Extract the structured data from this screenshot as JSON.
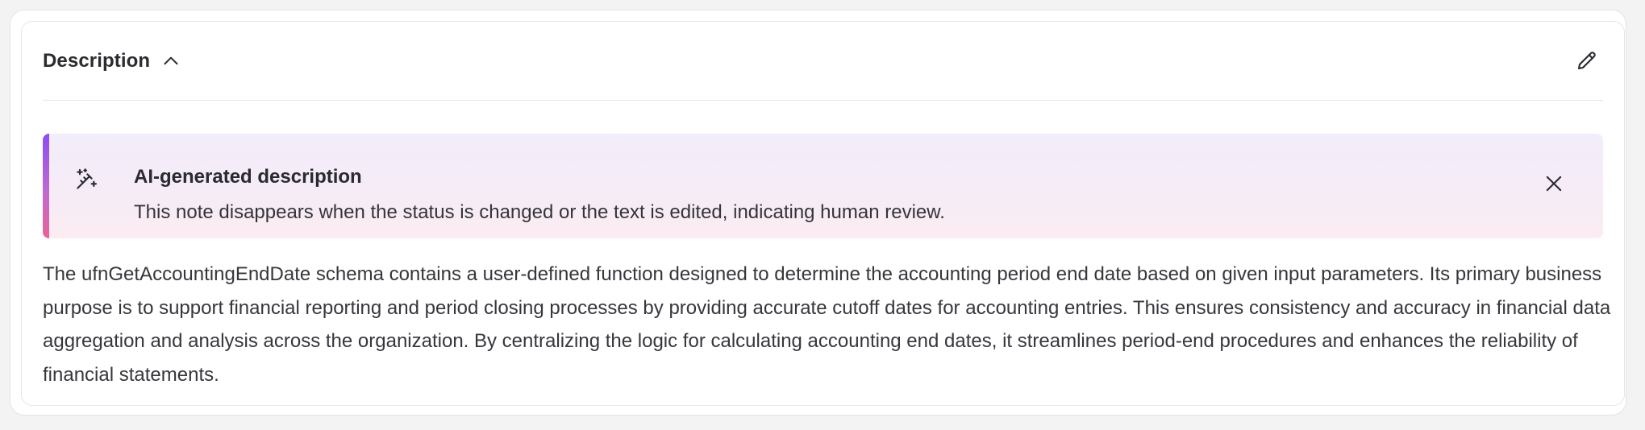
{
  "section": {
    "title": "Description",
    "collapse_icon": "chevron-up-icon",
    "edit_icon": "pencil-icon"
  },
  "ai_banner": {
    "icon": "magic-wand-icon",
    "title": "AI-generated description",
    "text": "This note disappears when the status is changed or the text is edited, indicating human review.",
    "close_icon": "close-icon",
    "colors": {
      "accent_top": "#8b4ef2",
      "accent_bottom": "#ea6399",
      "background": "#f3ecf8"
    }
  },
  "description": {
    "text": "The ufnGetAccountingEndDate schema contains a user-defined function designed to determine the accounting period end date based on given input parameters. Its primary business purpose is to support financial reporting and period closing processes by providing accurate cutoff dates for accounting entries. This ensures consistency and accuracy in financial data aggregation and analysis across the organization. By centralizing the logic for calculating accounting end dates, it streamlines period-end procedures and enhances the reliability of financial statements."
  }
}
